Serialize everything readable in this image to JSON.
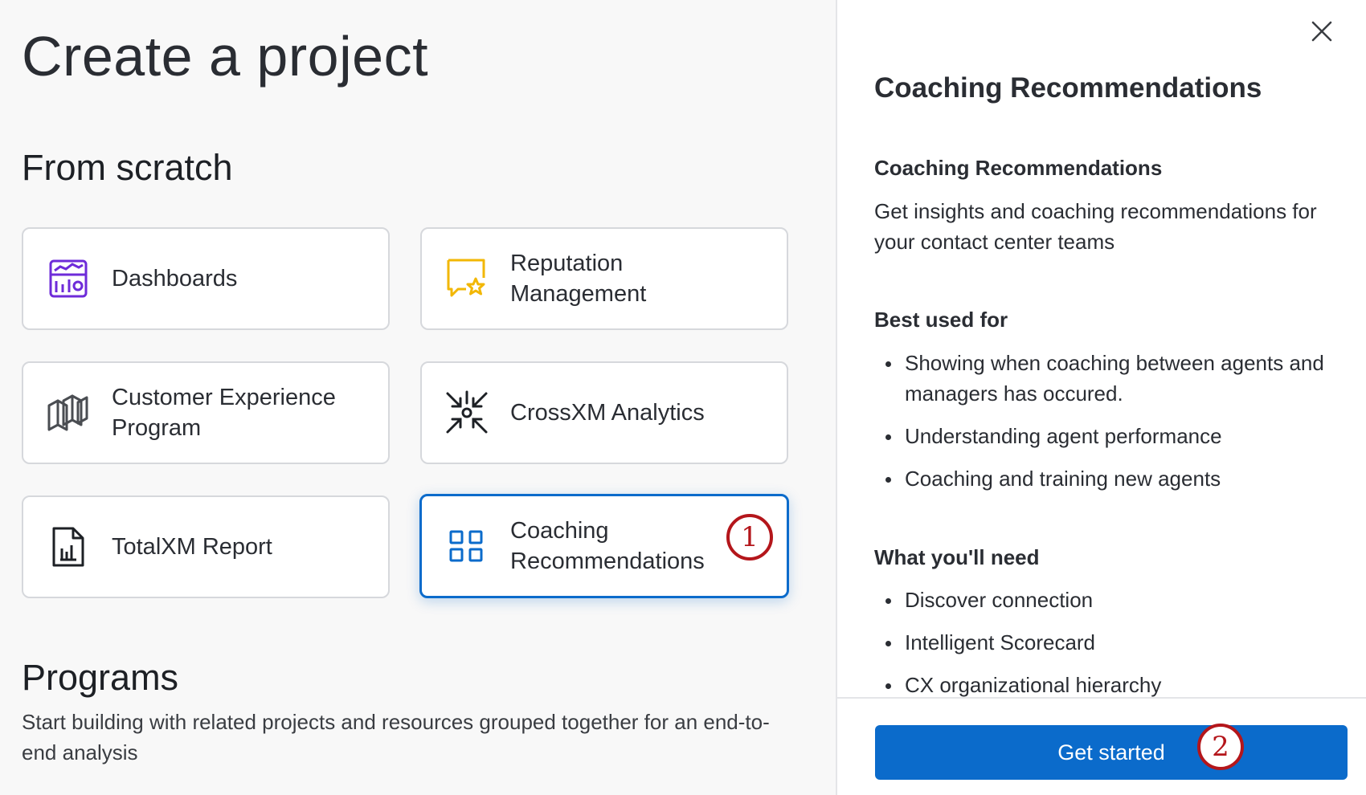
{
  "page": {
    "title": "Create a project"
  },
  "sections": {
    "from_scratch": "From scratch",
    "programs": {
      "title": "Programs",
      "description": "Start building with related projects and resources grouped together for an end-to-end analysis"
    }
  },
  "cards": [
    {
      "label": "Dashboards",
      "icon": "dashboard-icon",
      "color": "#6e2bd9"
    },
    {
      "label": "Reputation Management",
      "icon": "review-star-icon",
      "color": "#f2b705"
    },
    {
      "label": "Customer Experience Program",
      "icon": "cx-program-icon",
      "color": "#4a4d52"
    },
    {
      "label": "CrossXM Analytics",
      "icon": "crossxm-arrows-icon",
      "color": "#1d2025"
    },
    {
      "label": "TotalXM Report",
      "icon": "report-chart-icon",
      "color": "#1d2025"
    },
    {
      "label": "Coaching Recommendations",
      "icon": "grid-squares-icon",
      "color": "#0b6bcb",
      "selected": true
    }
  ],
  "callouts": {
    "one": "1",
    "two": "2"
  },
  "panel": {
    "title": "Coaching Recommendations",
    "subtitle": "Coaching Recommendations",
    "description": "Get insights and coaching recommendations for your contact center teams",
    "best_used_for": {
      "heading": "Best used for",
      "items": [
        "Showing when coaching between agents and managers has occured.",
        "Understanding agent performance",
        "Coaching and training new agents"
      ]
    },
    "what_you_need": {
      "heading": "What you'll need",
      "items": [
        "Discover connection",
        "Intelligent Scorecard",
        "CX organizational hierarchy"
      ]
    },
    "primary_button": "Get started",
    "close_icon": "close-icon"
  },
  "colors": {
    "accent": "#0b6bcb",
    "callout": "#b4161b"
  }
}
